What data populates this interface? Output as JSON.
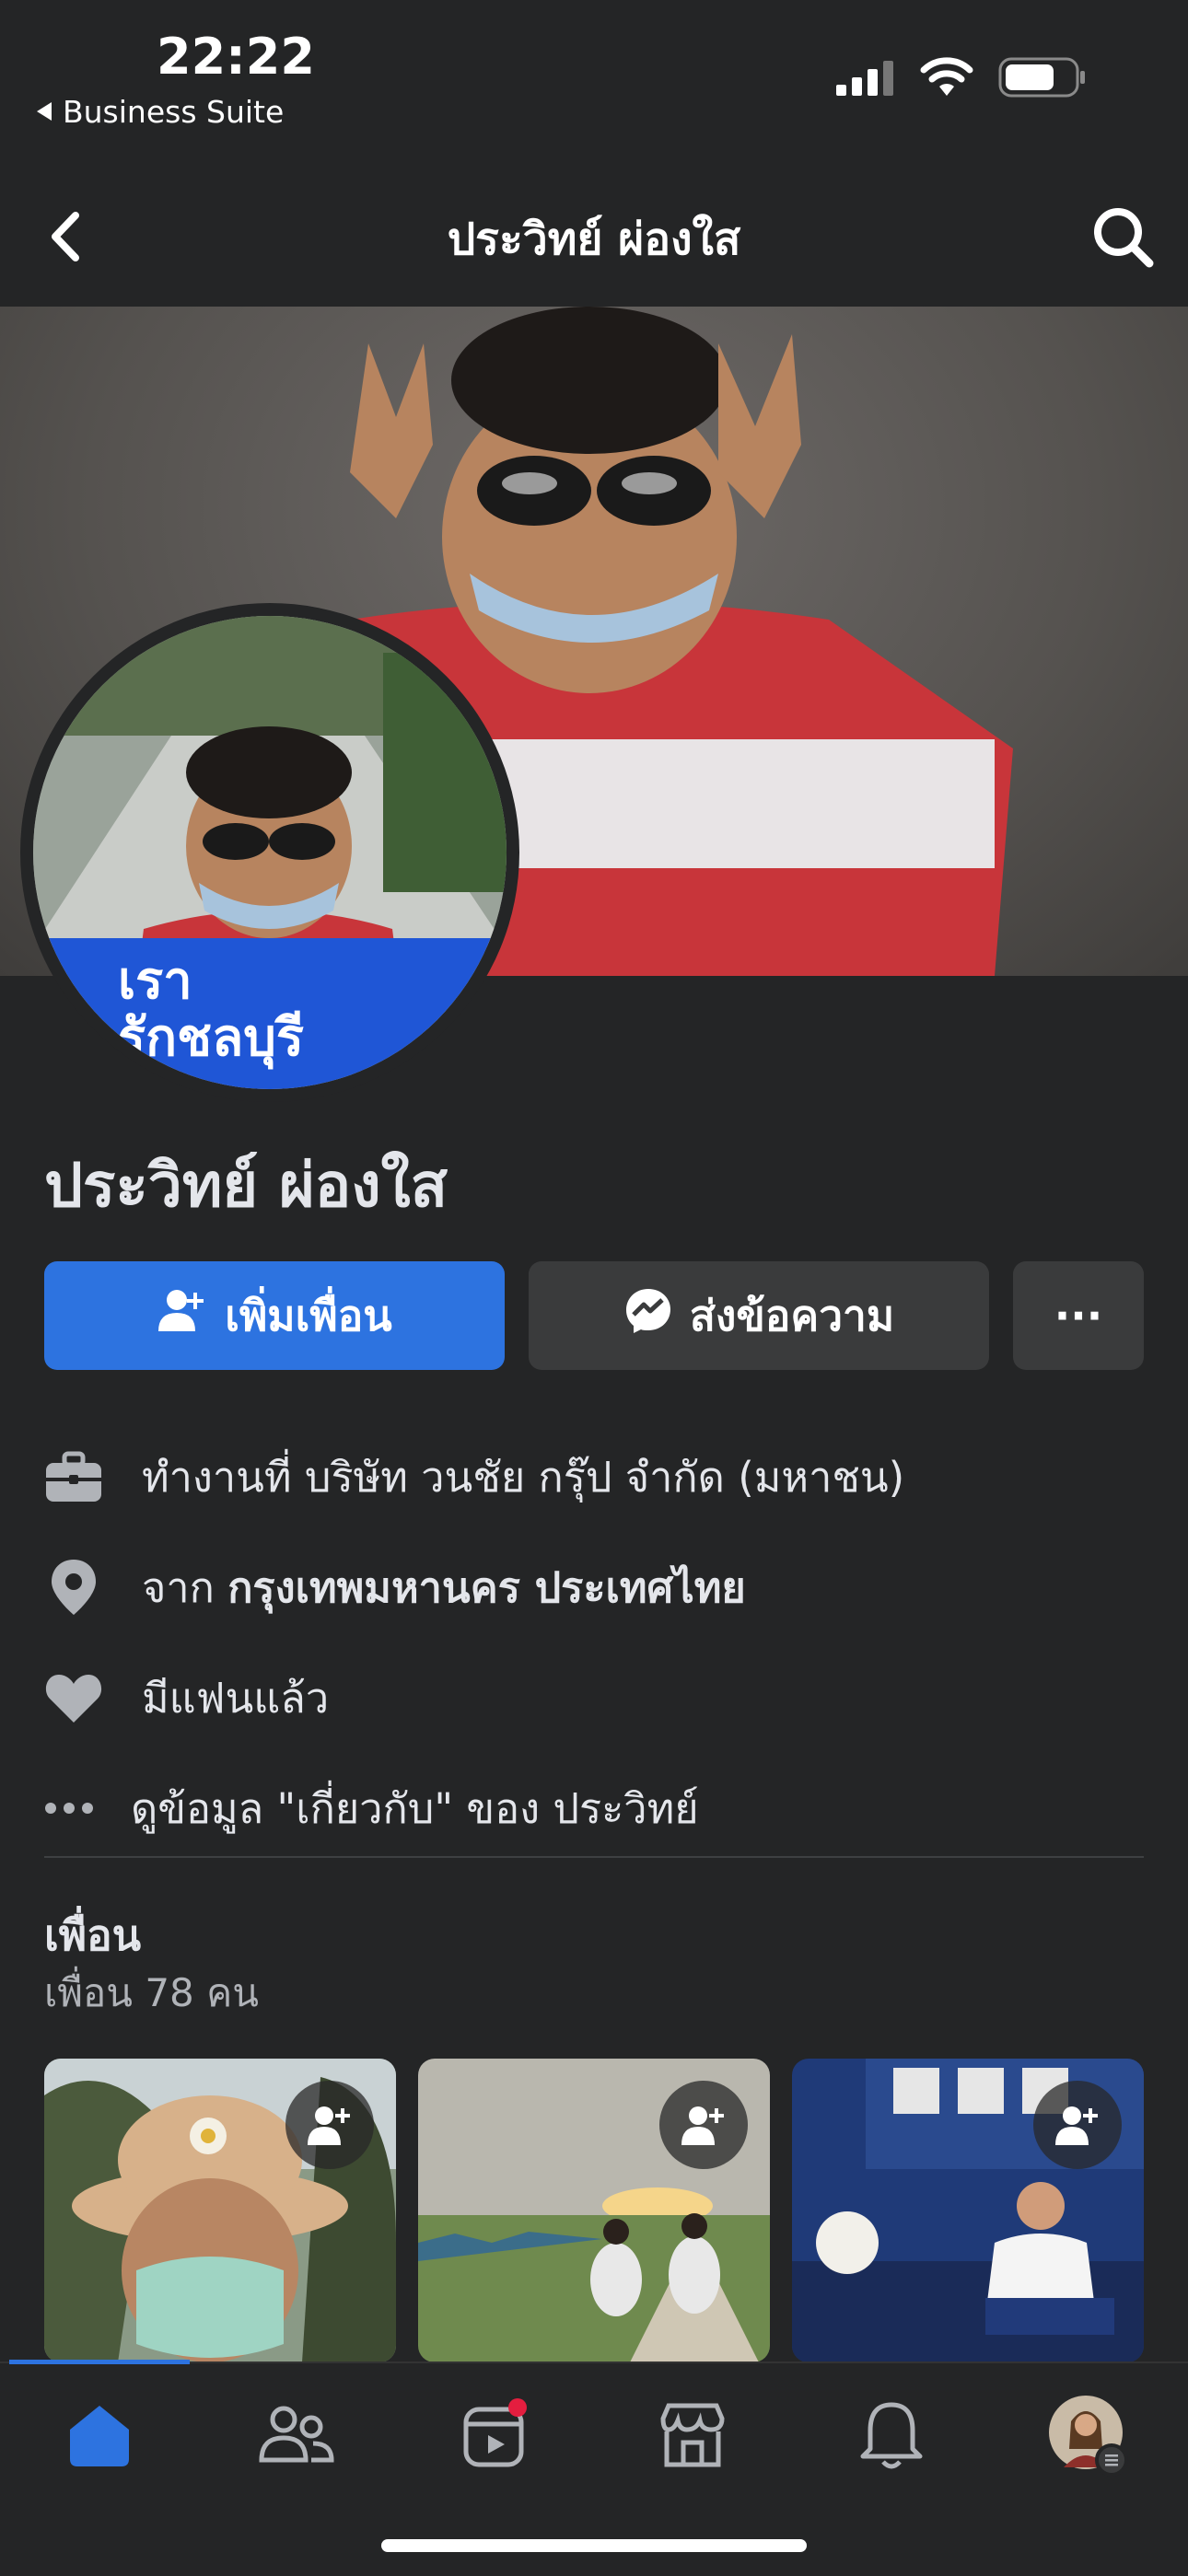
{
  "status": {
    "time": "22:22",
    "back_app": "Business Suite"
  },
  "nav": {
    "title": "ประวิทย์ ผ่องใส"
  },
  "avatar": {
    "frame_line1": "เรา",
    "frame_line2": "รักชลบุรี"
  },
  "profile": {
    "name": "ประวิทย์ ผ่องใส"
  },
  "actions": {
    "add_friend": "เพิ่มเพื่อน",
    "message": "ส่งข้อความ",
    "more": "···"
  },
  "info": {
    "work_prefix": "ทำงานที่ ",
    "work": "บริษัท วนชัย กรุ๊ป จำกัด (มหาชน)",
    "from_prefix": "จาก ",
    "from": "กรุงเทพมหานคร ประเทศไทย",
    "relationship": "มีแฟนแล้ว",
    "about_link": "ดูข้อมูล \"เกี่ยวกับ\" ของ ประวิทย์"
  },
  "friends": {
    "title": "เพื่อน",
    "count": "เพื่อน 78 คน"
  },
  "colors": {
    "accent": "#2d73e0",
    "background": "#242526",
    "button_secondary": "#3a3b3c",
    "notification_dot": "#e41e3f"
  },
  "icons": {
    "tabs": [
      "home-icon",
      "friends-icon",
      "video-icon",
      "marketplace-icon",
      "bell-icon",
      "profile-avatar"
    ]
  }
}
